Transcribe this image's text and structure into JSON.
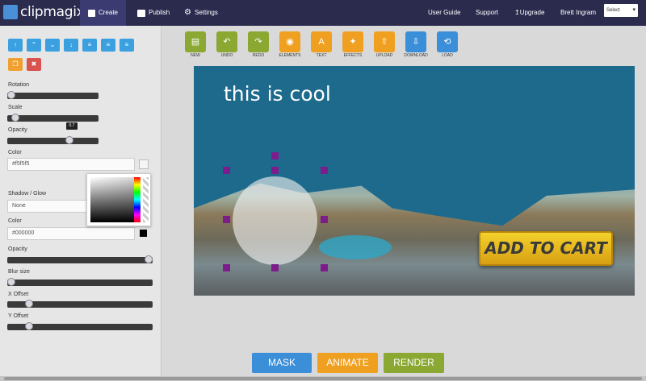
{
  "app": {
    "brand": "clipmagix"
  },
  "nav": {
    "items": [
      {
        "label": "Create",
        "icon": "video-camera-icon"
      },
      {
        "label": "Publish",
        "icon": "publish-icon"
      },
      {
        "label": "Settings",
        "icon": "gear-icon"
      }
    ],
    "right": {
      "user_guide": "User Guide",
      "support": "Support",
      "upgrade": "Upgrade",
      "user": "Brett Ingram",
      "select_value": "Select"
    }
  },
  "left_panel": {
    "align_buttons": [
      "arrow-up-icon",
      "chevron-up-icon",
      "chevron-down-icon",
      "arrow-down-icon",
      "align-left-icon",
      "align-center-icon",
      "align-right-icon"
    ],
    "action_buttons": [
      "copy-icon",
      "trash-icon"
    ],
    "rotation_label": "Rotation",
    "scale_label": "Scale",
    "opacity_label": "Opacity",
    "opacity_tooltip": "0.7",
    "color_label": "Color",
    "color_value": "#f5f5f5",
    "shadow_label": "Shadow / Glow",
    "shadow_value": "None",
    "shadow_color_label": "Color",
    "shadow_color_value": "#000000",
    "shadow_opacity_label": "Opacity",
    "blur_label": "Blur size",
    "xoffset_label": "X Offset",
    "yoffset_label": "Y Offset",
    "levels": {
      "rotation": 0.0,
      "scale": 0.05,
      "opacity": 0.7,
      "shadow_opacity": 1.0,
      "blur": 0.0,
      "xoffset": 0.13,
      "yoffset": 0.13
    }
  },
  "toolbar": [
    {
      "label": "NEW",
      "icon": "new-file-icon",
      "color": "#8aa832"
    },
    {
      "label": "UNDO",
      "icon": "undo-icon",
      "color": "#8aa832"
    },
    {
      "label": "REDO",
      "icon": "redo-icon",
      "color": "#8aa832"
    },
    {
      "label": "ELEMENTS",
      "icon": "eye-icon",
      "color": "#f0a020"
    },
    {
      "label": "TEXT",
      "icon": "text-icon",
      "color": "#f0a020"
    },
    {
      "label": "EFFECTS",
      "icon": "magic-wand-icon",
      "color": "#f0a020"
    },
    {
      "label": "UPLOAD",
      "icon": "upload-icon",
      "color": "#f0a020"
    },
    {
      "label": "DOWNLOAD",
      "icon": "download-icon",
      "color": "#3a8fd8"
    },
    {
      "label": "LOAD",
      "icon": "load-icon",
      "color": "#3a8fd8"
    }
  ],
  "canvas": {
    "text": "this is cool",
    "cart_button": "ADD TO CART",
    "background": "#1e6a8c",
    "handle_color": "#7d1d8c"
  },
  "bottom_buttons": {
    "mask": "MASK",
    "animate": "ANIMATE",
    "render": "RENDER"
  },
  "colors": {
    "nav_bg": "#2b2b4e",
    "mask": "#3a8fd8",
    "animate": "#f0a020",
    "render": "#8aa832"
  }
}
